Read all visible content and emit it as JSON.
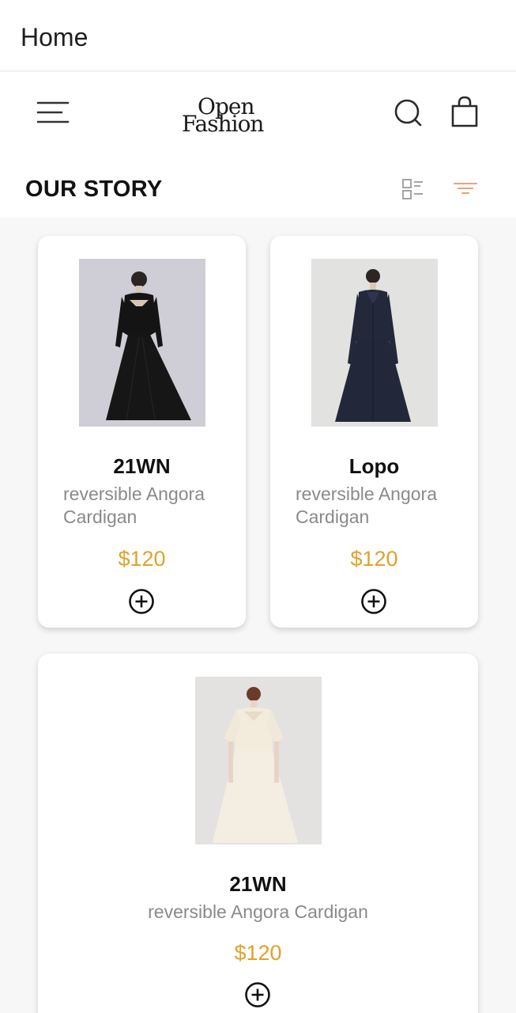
{
  "window": {
    "title": "Home"
  },
  "header": {
    "logo_line1": "Open",
    "logo_line2": "Fashion",
    "menu_icon": "hamburger-menu-icon",
    "search_icon": "search-icon",
    "bag_icon": "shopping-bag-icon"
  },
  "section": {
    "title": "OUR STORY",
    "view_icon": "list-view-icon",
    "filter_icon": "filter-icon",
    "accent": "#e8a27a"
  },
  "colors": {
    "price": "#e0a22a",
    "description": "#8a8a8a",
    "background": "#f7f7f7"
  },
  "products": [
    {
      "name": "21WN",
      "description": "reversible Angora Cardigan",
      "price": "$120",
      "image": "black-dress-photo",
      "add_icon": "plus-circle-icon"
    },
    {
      "name": "Lopo",
      "description": "reversible Angora Cardigan",
      "price": "$120",
      "image": "navy-coat-dress-photo",
      "add_icon": "plus-circle-icon"
    },
    {
      "name": "21WN",
      "description": "reversible Angora Cardigan",
      "price": "$120",
      "image": "cream-dress-photo",
      "add_icon": "plus-circle-icon"
    }
  ]
}
